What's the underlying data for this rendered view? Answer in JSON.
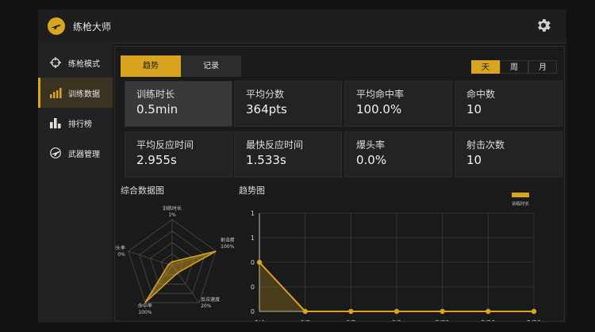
{
  "app": {
    "title": "练枪大师",
    "accent": "#d9a521"
  },
  "sidebar": {
    "items": [
      {
        "label": "练枪模式",
        "icon": "crosshair-icon",
        "active": false
      },
      {
        "label": "训练数据",
        "icon": "bar-chart-icon",
        "active": true
      },
      {
        "label": "排行榜",
        "icon": "leaderboard-icon",
        "active": false
      },
      {
        "label": "武器管理",
        "icon": "gun-icon",
        "active": false
      }
    ]
  },
  "tabs": [
    {
      "label": "趋势",
      "active": true
    },
    {
      "label": "记录",
      "active": false
    }
  ],
  "periods": [
    {
      "label": "天",
      "active": true
    },
    {
      "label": "周",
      "active": false
    },
    {
      "label": "月",
      "active": false
    }
  ],
  "stats": [
    {
      "label": "训练时长",
      "value": "0.5min"
    },
    {
      "label": "平均分数",
      "value": "364pts"
    },
    {
      "label": "平均命中率",
      "value": "100.0%"
    },
    {
      "label": "命中数",
      "value": "10"
    },
    {
      "label": "平均反应时间",
      "value": "2.955s"
    },
    {
      "label": "最快反应时间",
      "value": "1.533s"
    },
    {
      "label": "爆头率",
      "value": "0.0%"
    },
    {
      "label": "射击次数",
      "value": "10"
    }
  ],
  "radar": {
    "title": "综合数据图",
    "axes": [
      {
        "label": "训练时长",
        "value": "1%",
        "level": 0.01
      },
      {
        "label": "射击精度",
        "value": "100%",
        "level": 1.0
      },
      {
        "label": "反应速度",
        "value": "20%",
        "level": 0.2
      },
      {
        "label": "命中率",
        "value": "100%",
        "level": 1.0
      },
      {
        "label": "爆头率",
        "value": "0%",
        "level": 0.0
      }
    ]
  },
  "chart_data": {
    "type": "line",
    "title": "趋势图",
    "legend": "训练时长",
    "legend_position": "top-right",
    "grid": true,
    "color": "#d9a521",
    "categories": [
      "6/4",
      "6/3",
      "6/2",
      "6/1",
      "5/31",
      "5/30",
      "5/29"
    ],
    "values": [
      0.5,
      0,
      0,
      0,
      0,
      0,
      0
    ],
    "ylim": [
      0,
      1
    ],
    "yticks": [
      {
        "v": 0,
        "label": "0"
      },
      {
        "v": 0.25,
        "label": "0"
      },
      {
        "v": 0.5,
        "label": "0"
      },
      {
        "v": 0.75,
        "label": "1"
      },
      {
        "v": 1,
        "label": "1"
      }
    ],
    "series": [
      {
        "name": "训练时长",
        "values": [
          0.5,
          0,
          0,
          0,
          0,
          0,
          0
        ]
      }
    ]
  }
}
